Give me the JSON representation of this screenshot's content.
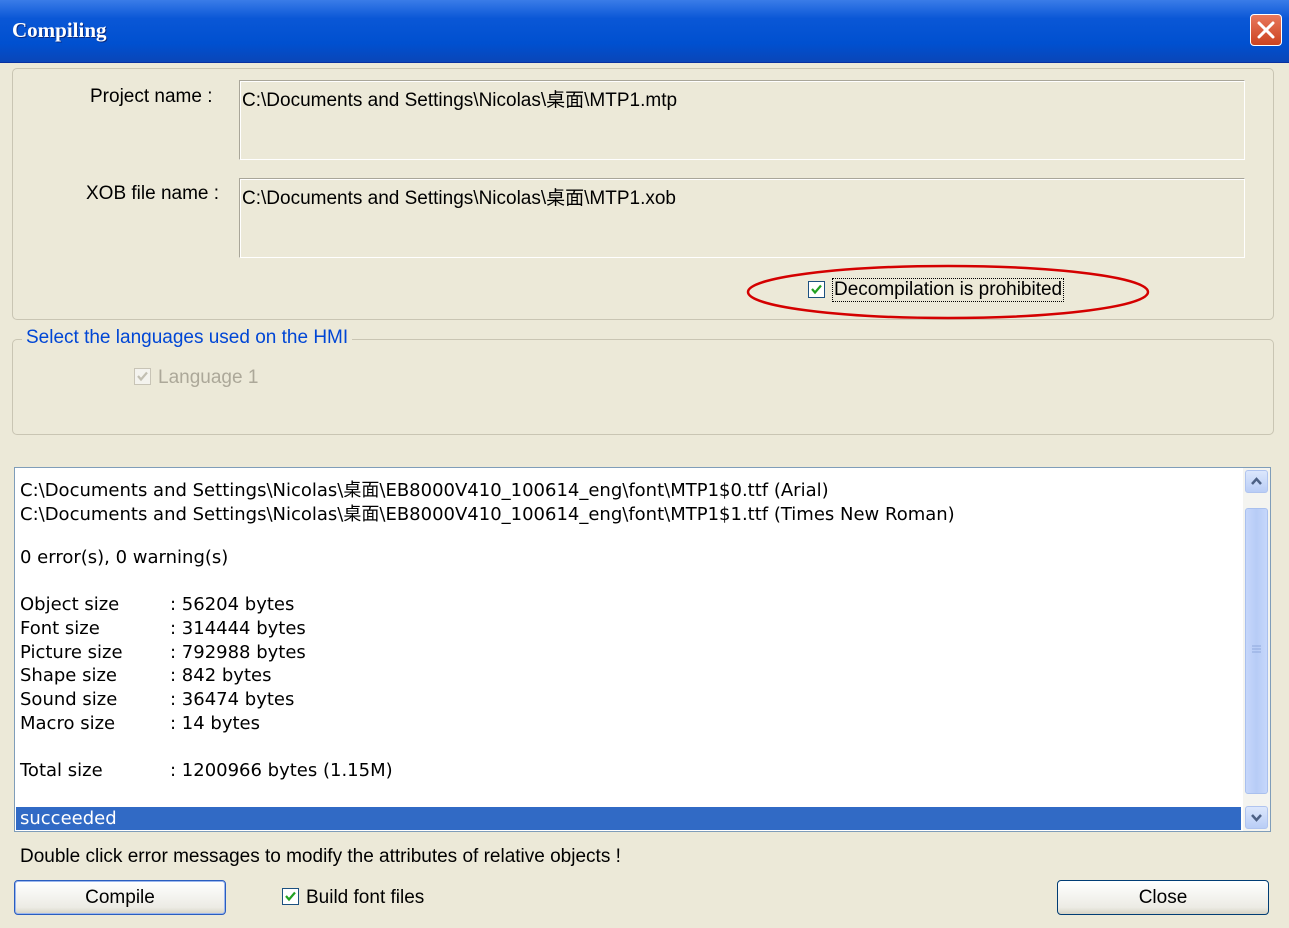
{
  "window": {
    "title": "Compiling"
  },
  "project": {
    "project_name_label": "Project name :",
    "project_name_value": "C:\\Documents and Settings\\Nicolas\\桌面\\MTP1.mtp",
    "xob_label": "XOB file name :",
    "xob_value": "C:\\Documents and Settings\\Nicolas\\桌面\\MTP1.xob",
    "decompile_label": "Decompilation is prohibited",
    "decompile_checked": true
  },
  "languages": {
    "group_label": "Select the languages used on the HMI",
    "items": [
      {
        "label": "Language 1",
        "checked": true,
        "enabled": false
      }
    ]
  },
  "log": {
    "font_lines": [
      "C:\\Documents and Settings\\Nicolas\\桌面\\EB8000V410_100614_eng\\font\\MTP1$0.ttf (Arial)",
      "C:\\Documents and Settings\\Nicolas\\桌面\\EB8000V410_100614_eng\\font\\MTP1$1.ttf (Times New Roman)"
    ],
    "summary": "0 error(s), 0 warning(s)",
    "sizes": [
      {
        "label": "Object size",
        "value": ": 56204 bytes"
      },
      {
        "label": "Font size",
        "value": ": 314444 bytes"
      },
      {
        "label": "Picture size",
        "value": ": 792988 bytes"
      },
      {
        "label": "Shape size",
        "value": ": 842 bytes"
      },
      {
        "label": "Sound size",
        "value": ": 36474 bytes"
      },
      {
        "label": "Macro size",
        "value": ": 14 bytes"
      }
    ],
    "total": {
      "label": "Total size",
      "value": ": 1200966 bytes (1.15M)"
    },
    "status": "succeeded"
  },
  "hint": "Double click  error messages  to modify the attributes of  relative objects !",
  "footer": {
    "compile_label": "Compile",
    "build_font_label": "Build font files",
    "build_font_checked": true,
    "close_label": "Close"
  },
  "colors": {
    "title_bar": "#0054e3",
    "selection": "#316ac5",
    "annotation": "#d40000"
  }
}
